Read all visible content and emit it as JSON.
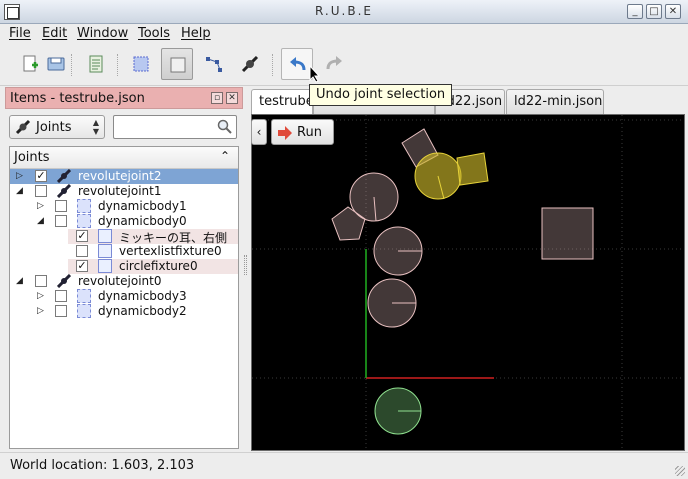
{
  "window": {
    "title": "R.U.B.E",
    "controls": {
      "minimize": "_",
      "maximize": "□",
      "close": "✕"
    }
  },
  "menu": [
    "File",
    "Edit",
    "Window",
    "Tools",
    "Help"
  ],
  "toolbar": {
    "tooltip": "Undo joint selection",
    "buttons": [
      "new-scene",
      "save",
      "script",
      "select-bodies",
      "select-fixtures",
      "select-vertices",
      "select-joints",
      "undo",
      "redo"
    ]
  },
  "items_panel": {
    "title": "Items - testrube.json",
    "filter_value": "Joints",
    "search_value": "",
    "column_header": "Joints",
    "rows": [
      {
        "label": "revolutejoint2",
        "checked": true,
        "expander": "▷"
      },
      {
        "label": "revolutejoint1",
        "checked": false,
        "expander": "◢"
      },
      {
        "label": "dynamicbody1",
        "checked": false,
        "expander": "▷"
      },
      {
        "label": "dynamicbody0",
        "checked": false,
        "expander": "◢"
      },
      {
        "label": "ミッキーの耳、右側",
        "checked": true,
        "expander": ""
      },
      {
        "label": "vertexlistfixture0",
        "checked": false,
        "expander": ""
      },
      {
        "label": "circlefixture0",
        "checked": true,
        "expander": ""
      },
      {
        "label": "revolutejoint0",
        "checked": false,
        "expander": "◢"
      },
      {
        "label": "dynamicbody3",
        "checked": false,
        "expander": "▷"
      },
      {
        "label": "dynamicbody2",
        "checked": false,
        "expander": "▷"
      }
    ]
  },
  "tabs": [
    "testrube",
    "…",
    "ld22.json",
    "ld22-min.json"
  ],
  "scene": {
    "back_label": "‹",
    "run_label": "Run"
  },
  "status": {
    "world_location": "World location: 1.603, 2.103"
  },
  "colors": {
    "selection": "#7ea4d4",
    "dock_title": "#eab0b0",
    "selected_body": "#c9b52a",
    "ground_body": "#7fd07f"
  }
}
